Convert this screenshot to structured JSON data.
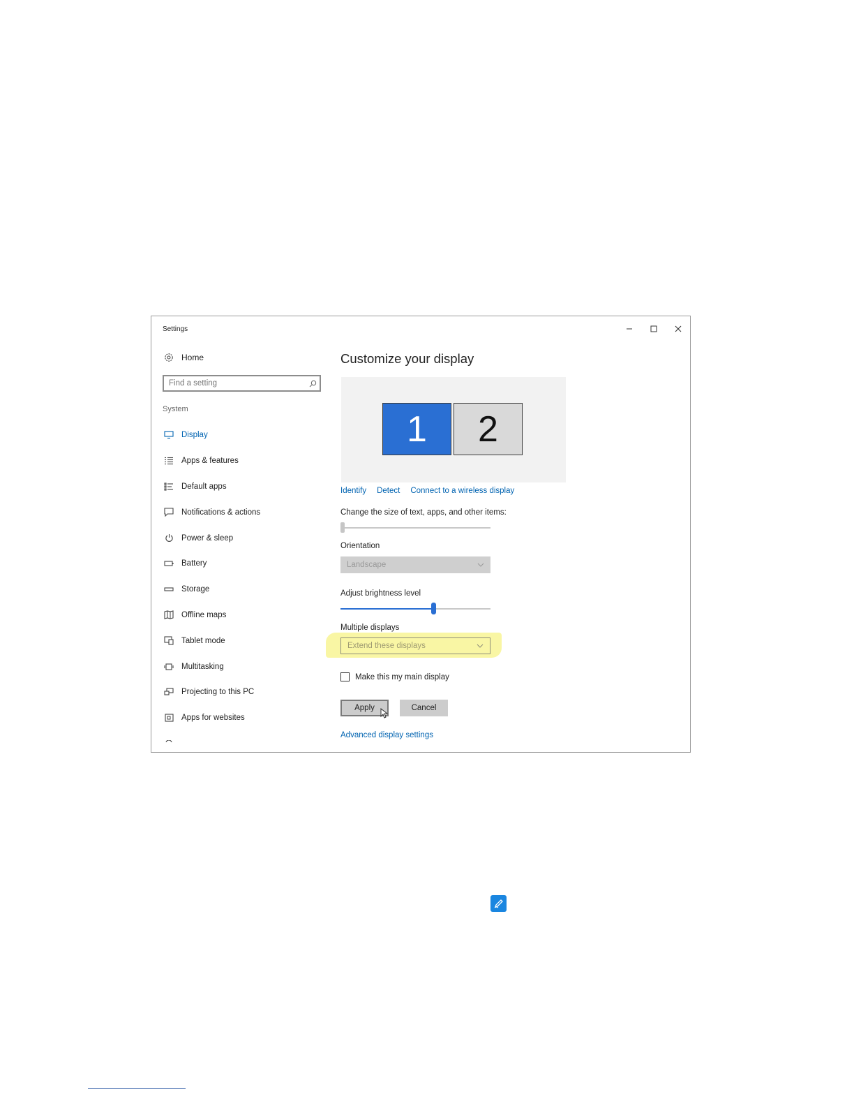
{
  "window": {
    "title": "Settings"
  },
  "sidebar": {
    "home_label": "Home",
    "search_placeholder": "Find a setting",
    "section_label": "System",
    "items": [
      {
        "label": "Display",
        "icon": "monitor-icon",
        "active": true
      },
      {
        "label": "Apps & features",
        "icon": "list-icon"
      },
      {
        "label": "Default apps",
        "icon": "default-apps-icon"
      },
      {
        "label": "Notifications & actions",
        "icon": "notification-icon"
      },
      {
        "label": "Power & sleep",
        "icon": "power-icon"
      },
      {
        "label": "Battery",
        "icon": "battery-icon"
      },
      {
        "label": "Storage",
        "icon": "storage-icon"
      },
      {
        "label": "Offline maps",
        "icon": "map-icon"
      },
      {
        "label": "Tablet mode",
        "icon": "tablet-mode-icon"
      },
      {
        "label": "Multitasking",
        "icon": "multitasking-icon"
      },
      {
        "label": "Projecting to this PC",
        "icon": "projecting-icon"
      },
      {
        "label": "Apps for websites",
        "icon": "apps-for-websites-icon"
      }
    ]
  },
  "main": {
    "title": "Customize your display",
    "monitors": [
      "1",
      "2"
    ],
    "links": {
      "identify": "Identify",
      "detect": "Detect",
      "wireless": "Connect to a wireless display"
    },
    "scale_label": "Change the size of text, apps, and other items:",
    "scale_value": 0,
    "orientation_label": "Orientation",
    "orientation_value": "Landscape",
    "brightness_label": "Adjust brightness level",
    "brightness_value": 0.62,
    "multiple_label": "Multiple displays",
    "multiple_value": "Extend these displays",
    "main_display_label": "Make this my main display",
    "main_display_checked": false,
    "apply_label": "Apply",
    "cancel_label": "Cancel",
    "advanced_label": "Advanced display settings"
  },
  "colors": {
    "accent": "#0063b1",
    "monitor_selected": "#2a6fd3",
    "highlight": "#f8f59a"
  }
}
